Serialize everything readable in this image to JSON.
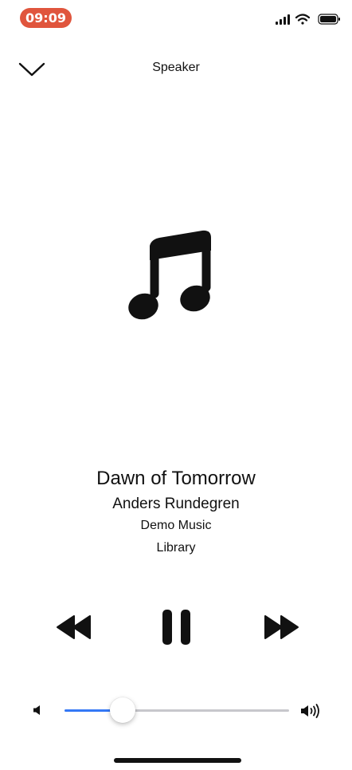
{
  "status_bar": {
    "time": "09:09",
    "time_pill_color": "#e0553d",
    "icons": [
      "cellular-signal-icon",
      "wifi-icon",
      "battery-icon"
    ]
  },
  "header": {
    "title": "Speaker",
    "collapse_icon": "chevron-down-icon"
  },
  "artwork": {
    "icon": "music-note-icon"
  },
  "track": {
    "title": "Dawn of Tomorrow",
    "artist": "Anders Rundegren",
    "album": "Demo Music",
    "source": "Library"
  },
  "controls": {
    "rewind_icon": "rewind-icon",
    "pause_icon": "pause-icon",
    "forward_icon": "fast-forward-icon"
  },
  "volume": {
    "level": 0.26,
    "low_icon": "volume-low-icon",
    "high_icon": "volume-high-icon",
    "fill_color": "#3478f6",
    "track_color": "#c7c7cc"
  }
}
